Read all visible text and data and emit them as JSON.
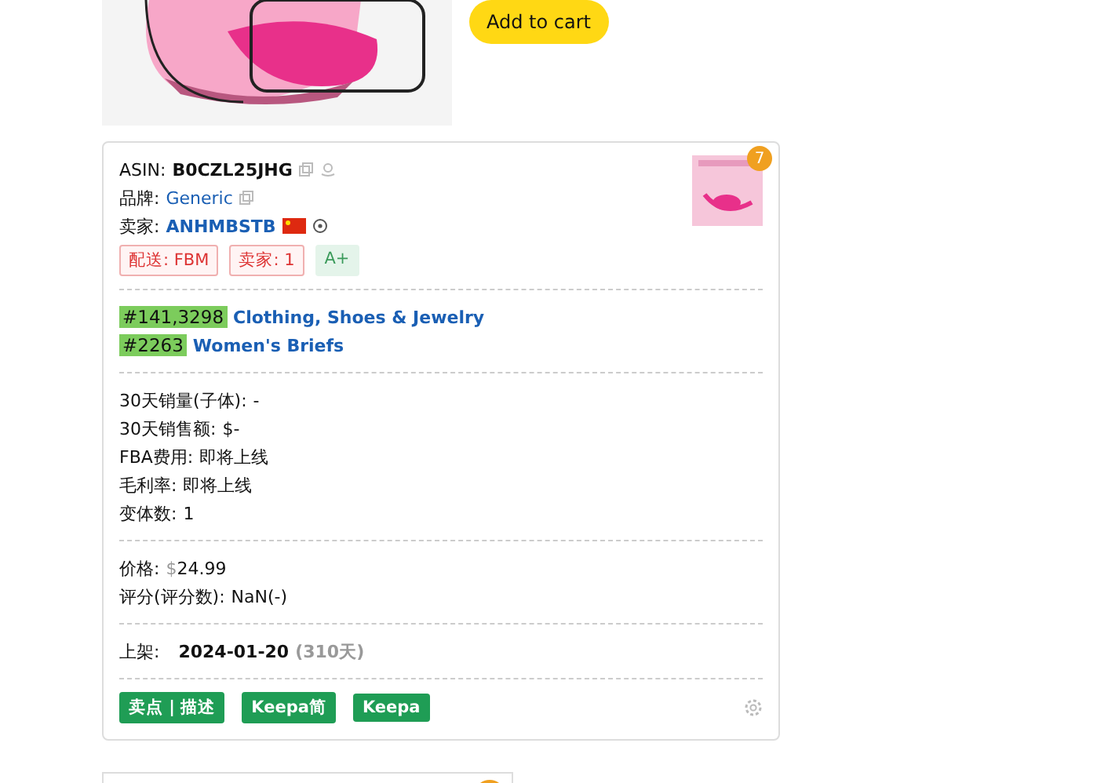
{
  "top": {
    "button": "Add to cart"
  },
  "card": {
    "asin_label": "ASIN:",
    "asin": "B0CZL25JHG",
    "badge": "7",
    "brand_label": "品牌:",
    "brand": "Generic",
    "seller_label": "卖家:",
    "seller": "ANHMBSTB",
    "tags": [
      {
        "text": "配送: FBM",
        "kind": "red"
      },
      {
        "text": "卖家: 1",
        "kind": "red"
      },
      {
        "text": "A+",
        "kind": "green"
      }
    ],
    "ranks": [
      {
        "rank": "#141,3298",
        "category": "Clothing, Shoes & Jewelry"
      },
      {
        "rank": "#2263",
        "category": "Women's Briefs"
      }
    ],
    "stats": [
      {
        "label": "30天销量(子体):",
        "value": "-"
      },
      {
        "label": "30天销售额:",
        "value": "$-"
      },
      {
        "label": "FBA费用:",
        "value": "即将上线"
      },
      {
        "label": "毛利率:",
        "value": "即将上线"
      },
      {
        "label": "变体数:",
        "value": "1"
      }
    ],
    "price_label": "价格:",
    "price_currency": "$",
    "price": "24.99",
    "rating_label": "评分(评分数):",
    "rating": "NaN(-)",
    "listed_label": "上架:",
    "listed_date": "2024-01-20",
    "listed_days": "(310天)",
    "buttons": [
      "卖点 | 描述",
      "Keepa简",
      "Keepa"
    ]
  }
}
